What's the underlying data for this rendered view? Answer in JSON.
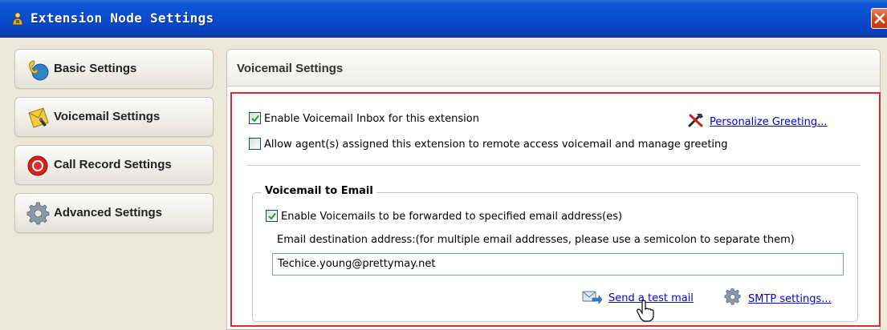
{
  "window": {
    "title": "Extension Node Settings"
  },
  "sidebar": {
    "items": [
      {
        "label": "Basic Settings",
        "icon": "globe-phone-icon"
      },
      {
        "label": "Voicemail Settings",
        "icon": "voicemail-icon"
      },
      {
        "label": "Call Record Settings",
        "icon": "record-icon"
      },
      {
        "label": "Advanced Settings",
        "icon": "gear-icon"
      }
    ]
  },
  "panel": {
    "title": "Voicemail Settings",
    "enable_inbox": {
      "label": "Enable Voicemail Inbox for this extension",
      "checked": true
    },
    "remote_access": {
      "label": "Allow agent(s) assigned this extension to remote access voicemail and manage greeting",
      "checked": false
    },
    "personalize_link": "Personalize Greeting...",
    "email_group": {
      "title": "Voicemail to Email",
      "forward": {
        "label": "Enable Voicemails to be forwarded to specified email address(es)",
        "checked": true
      },
      "dest_label": "Email destination address:(for multiple email addresses, please use a semicolon to separate them)",
      "dest_value": "Techice.young@prettymay.net",
      "test_mail_link": "Send a test mail",
      "smtp_link": "SMTP settings..."
    }
  },
  "colors": {
    "titlebar": "#0a4ccc",
    "highlight": "#e5272d",
    "link": "#0000e6",
    "close": "#d3491c"
  }
}
